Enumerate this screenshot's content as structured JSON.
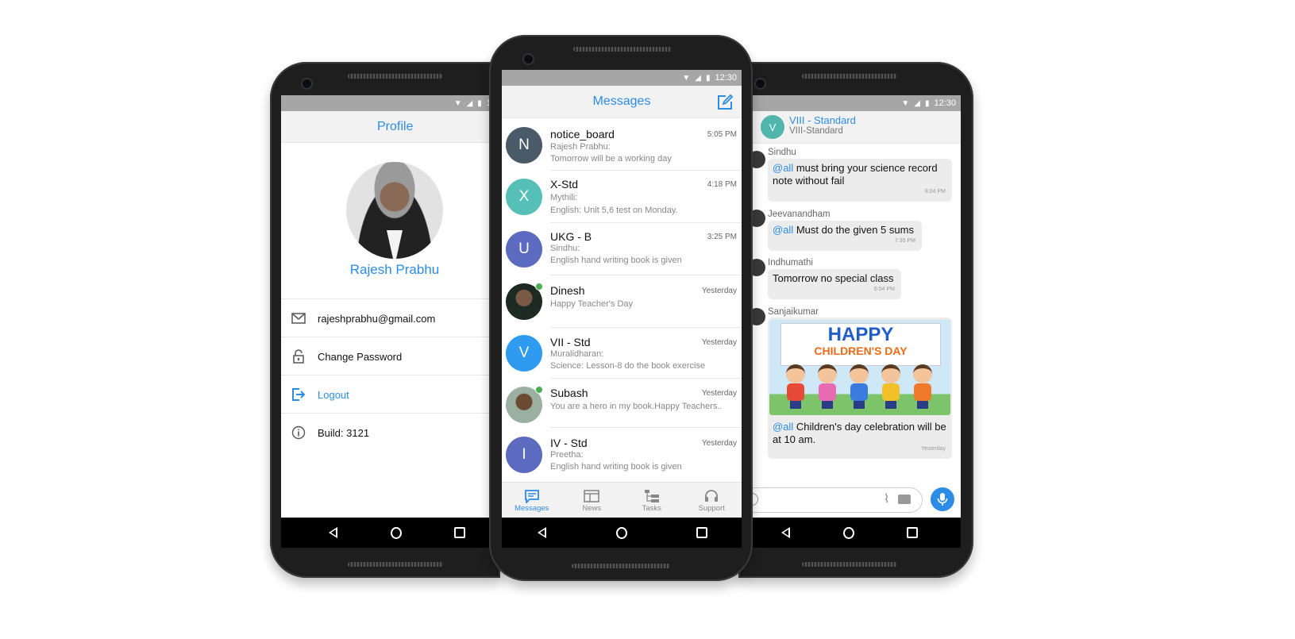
{
  "status": {
    "time": "12:30",
    "time_left_partial": "1:"
  },
  "profile": {
    "title": "Profile",
    "name": "Rajesh Prabhu",
    "email": "rajeshprabhu@gmail.com",
    "change_password": "Change Password",
    "logout": "Logout",
    "build": "Build: 3121"
  },
  "messages": {
    "title": "Messages",
    "items": [
      {
        "initial": "N",
        "title": "notice_board",
        "time": "5:05 PM",
        "line1": "Rajesh Prabhu:",
        "line2": "Tomorrow will be a working day",
        "color": "#4b5a68"
      },
      {
        "initial": "X",
        "title": "X-Std",
        "time": "4:18 PM",
        "line1": "Mythili:",
        "line2": "English: Unit 5,6 test on Monday.",
        "color": "#56bfb7"
      },
      {
        "initial": "U",
        "title": "UKG - B",
        "time": "3:25 PM",
        "line1": "Sindhu:",
        "line2": "English hand writing book is given",
        "color": "#5c6bc0"
      },
      {
        "initial": "",
        "title": "Dinesh",
        "time": "Yesterday",
        "line1": "Happy Teacher's Day",
        "line2": "",
        "color": "#3a4a3a"
      },
      {
        "initial": "V",
        "title": "VII - Std",
        "time": "Yesterday",
        "line1": "Muralidharan:",
        "line2": "Science: Lesson-8 do the book exercise",
        "color": "#2e9bf0"
      },
      {
        "initial": "",
        "title": "Subash",
        "time": "Yesterday",
        "line1": "You are a hero in my book.Happy Teachers..",
        "line2": "",
        "color": "#5a4030"
      },
      {
        "initial": "I",
        "title": "IV - Std",
        "time": "Yesterday",
        "line1": "Preetha:",
        "line2": "English hand writing book is given",
        "color": "#5c6bc0"
      }
    ],
    "tabs": [
      "Messages",
      "News",
      "Tasks",
      "Support"
    ]
  },
  "chat": {
    "avatar_initial": "V",
    "title": "VIII - Standard",
    "subtitle": "VIII-Standard",
    "mention": "@all",
    "messages": [
      {
        "sender": "Sindhu",
        "text": "must bring your science record note without fail",
        "time": "8:04 PM"
      },
      {
        "sender": "Jeevanandham",
        "text": "Must do the given 5 sums",
        "time": "7:35 PM"
      },
      {
        "sender": "Indhumathi",
        "text": "Tomorrow no special class",
        "time": "6:04 PM"
      },
      {
        "sender": "Sanjaikumar",
        "text": "Children's day celebration will be at 10 am.",
        "time": "Yesterday"
      }
    ],
    "image_text": {
      "line1": "HAPPY",
      "line2": "CHILDREN'S DAY"
    }
  },
  "colors": {
    "accent": "#2c8ce6",
    "online": "#4caf50"
  }
}
